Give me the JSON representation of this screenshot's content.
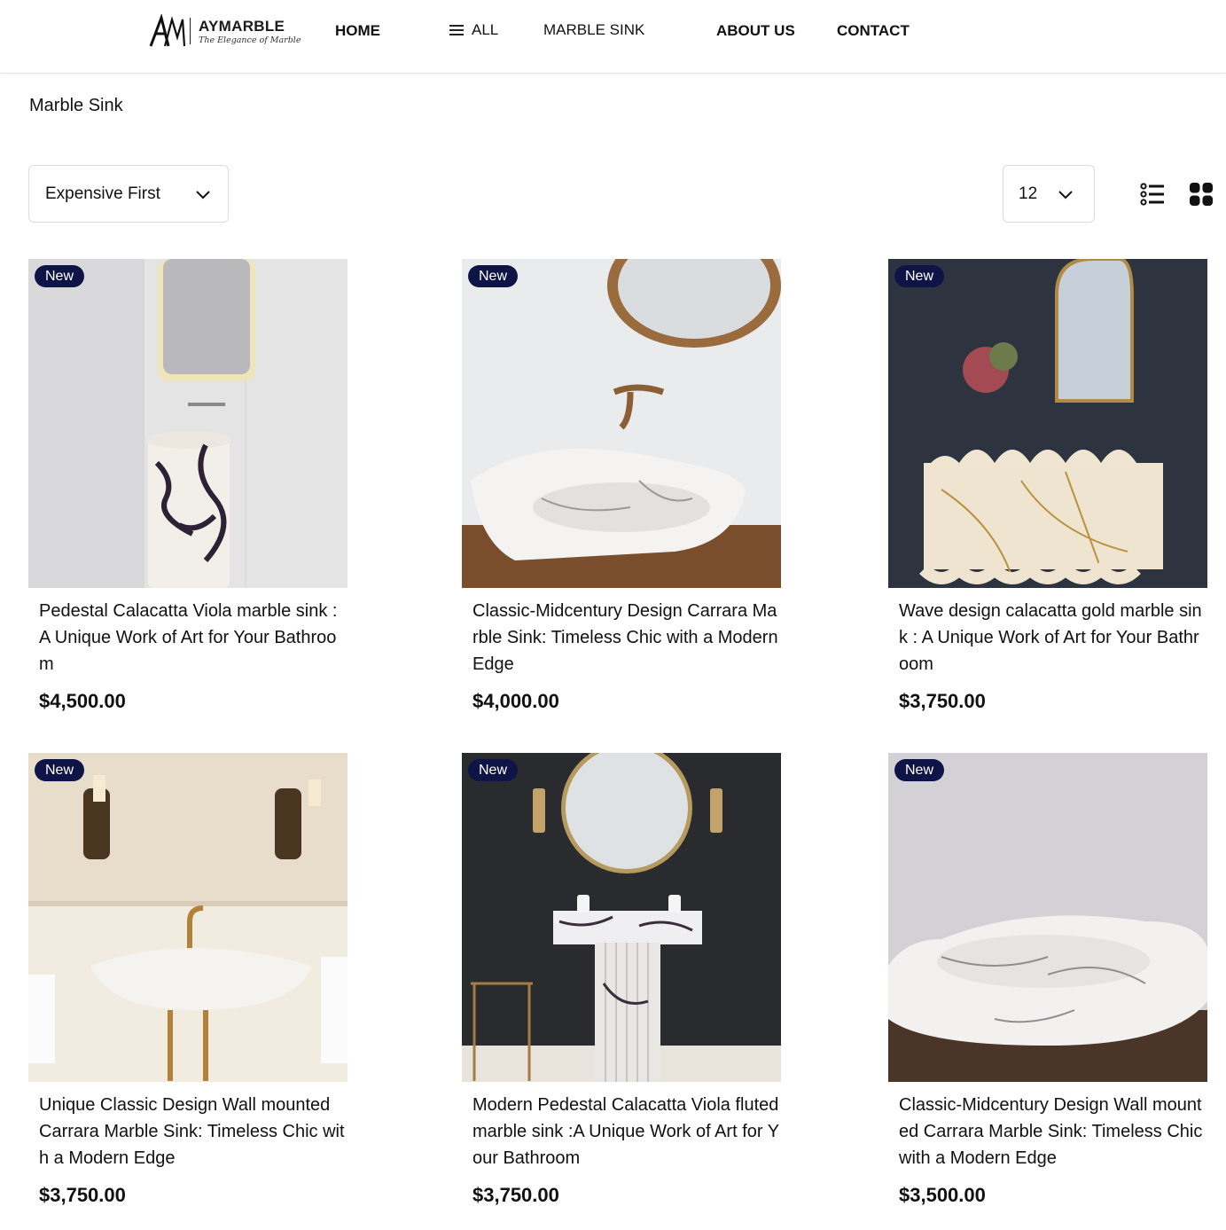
{
  "header": {
    "logo": {
      "name": "AYMARBLE",
      "tagline": "The Elegance of Marble"
    },
    "nav": {
      "home": "HOME",
      "all": "ALL",
      "marble_sink": "MARBLE SINK",
      "about": "ABOUT US",
      "contact": "CONTACT"
    }
  },
  "page": {
    "title": "Marble Sink"
  },
  "controls": {
    "sort": {
      "selected": "Expensive First"
    },
    "per_page": {
      "selected": "12"
    },
    "view_modes": [
      "list-view-icon",
      "grid-view-icon"
    ]
  },
  "colors": {
    "badge": "#0f1446",
    "text": "#111111",
    "border": "#dcdcdc"
  },
  "products": [
    {
      "badge": "New",
      "title": "Pedestal Calacatta Viola marble sink :A Unique Work of Art for Your Bathroom",
      "price": "$4,500.00"
    },
    {
      "badge": "New",
      "title": "Classic-Midcentury Design Carrara Marble Sink: Timeless Chic with a Modern Edge",
      "price": "$4,000.00"
    },
    {
      "badge": "New",
      "title": "Wave design calacatta gold marble sink : A Unique Work of Art for Your Bathroom",
      "price": "$3,750.00"
    },
    {
      "badge": "New",
      "title": "Unique Classic Design Wall mounted Carrara Marble Sink: Timeless Chic with a Modern Edge",
      "price": "$3,750.00"
    },
    {
      "badge": "New",
      "title": "Modern Pedestal Calacatta Viola fluted marble sink :A Unique Work of Art for Your Bathroom",
      "price": "$3,750.00"
    },
    {
      "badge": "New",
      "title": "Classic-Midcentury Design Wall mounted Carrara Marble Sink: Timeless Chic with a Modern Edge",
      "price": "$3,500.00"
    }
  ]
}
